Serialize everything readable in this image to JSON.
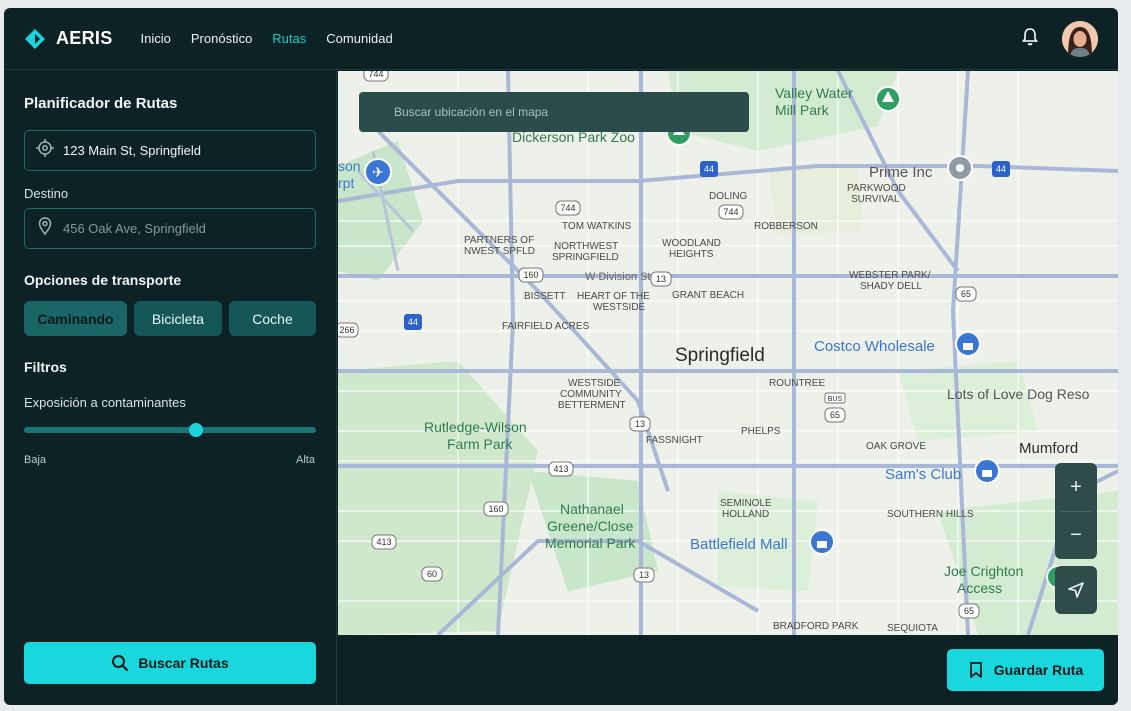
{
  "app": {
    "brand": "AERIS"
  },
  "nav": [
    {
      "label": "Inicio",
      "active": false
    },
    {
      "label": "Pronóstico",
      "active": false
    },
    {
      "label": "Rutas",
      "active": true
    },
    {
      "label": "Comunidad",
      "active": false
    }
  ],
  "header": {
    "icons": [
      "bell-icon",
      "avatar"
    ]
  },
  "planner": {
    "title": "Planificador de Rutas",
    "origin_value": "123 Main St, Springfield",
    "destination_label": "Destino",
    "destination_placeholder": "456 Oak Ave, Springfield",
    "transport_title": "Opciones de transporte",
    "transport_options": [
      {
        "label": "Caminando",
        "selected": true
      },
      {
        "label": "Bicicleta",
        "selected": false
      },
      {
        "label": "Coche",
        "selected": false
      }
    ],
    "filters_title": "Filtros",
    "pollutant_label": "Exposición a contaminantes",
    "pollutant_level": 0.59,
    "slider_min_label": "Baja",
    "slider_max_label": "Alta",
    "search_button": "Buscar Rutas"
  },
  "map": {
    "search_placeholder": "Buscar ubicación en el mapa",
    "zoom_in": "+",
    "zoom_out": "−",
    "labels": {
      "springfield": "Springfield",
      "valley_water": "Valley Water\nMill Park",
      "dickerson": "Dickerson Park Zoo",
      "prime_inc": "Prime Inc",
      "parkwood": "PARKWOOD\nSURVIVAL",
      "doling": "DOLING",
      "tom_watkins": "TOM WATKINS",
      "robberson": "ROBBERSON",
      "partners": "PARTNERS OF\nNWEST SPFLD",
      "northwest": "NORTHWEST\nSPRINGFIELD",
      "woodland": "WOODLAND\nHEIGHTS",
      "division": "W Division St",
      "webster": "WEBSTER PARK/\nSHADY DELL",
      "bissett": "BISSETT",
      "heart": "HEART OF THE\nWESTSIDE",
      "grant_beach": "GRANT BEACH",
      "fairfield": "FAIRFIELD ACRES",
      "costco": "Costco Wholesale",
      "lots_of_love": "Lots of Love Dog Reso",
      "westside": "WESTSIDE\nCOMMUNITY\nBETTERMENT",
      "rountree": "ROUNTREE",
      "rutledge": "Rutledge-Wilson\nFarm Park",
      "fassnight": "FASSNIGHT",
      "phelps": "PHELPS",
      "oak_grove": "OAK GROVE",
      "mumford": "Mumford",
      "sams": "Sam's Club",
      "seminole": "SEMINOLE\nHOLLAND",
      "southern_hills": "SOUTHERN HILLS",
      "nathanael": "Nathanael\nGreene/Close\nMemorial Park",
      "battlefield": "Battlefield Mall",
      "joe_crighton": "Joe Crighton\nAccess",
      "bradford": "BRADFORD PARK",
      "sequiota": "SEQUIOTA",
      "airport": "son\nrpt",
      "bus": "BUS"
    },
    "shields": [
      "744",
      "744",
      "744",
      "160",
      "13",
      "13",
      "13",
      "413",
      "413",
      "160",
      "60",
      "65",
      "65",
      "65",
      "266",
      "44",
      "44",
      "44"
    ]
  },
  "footer": {
    "save_button": "Guardar Ruta"
  }
}
